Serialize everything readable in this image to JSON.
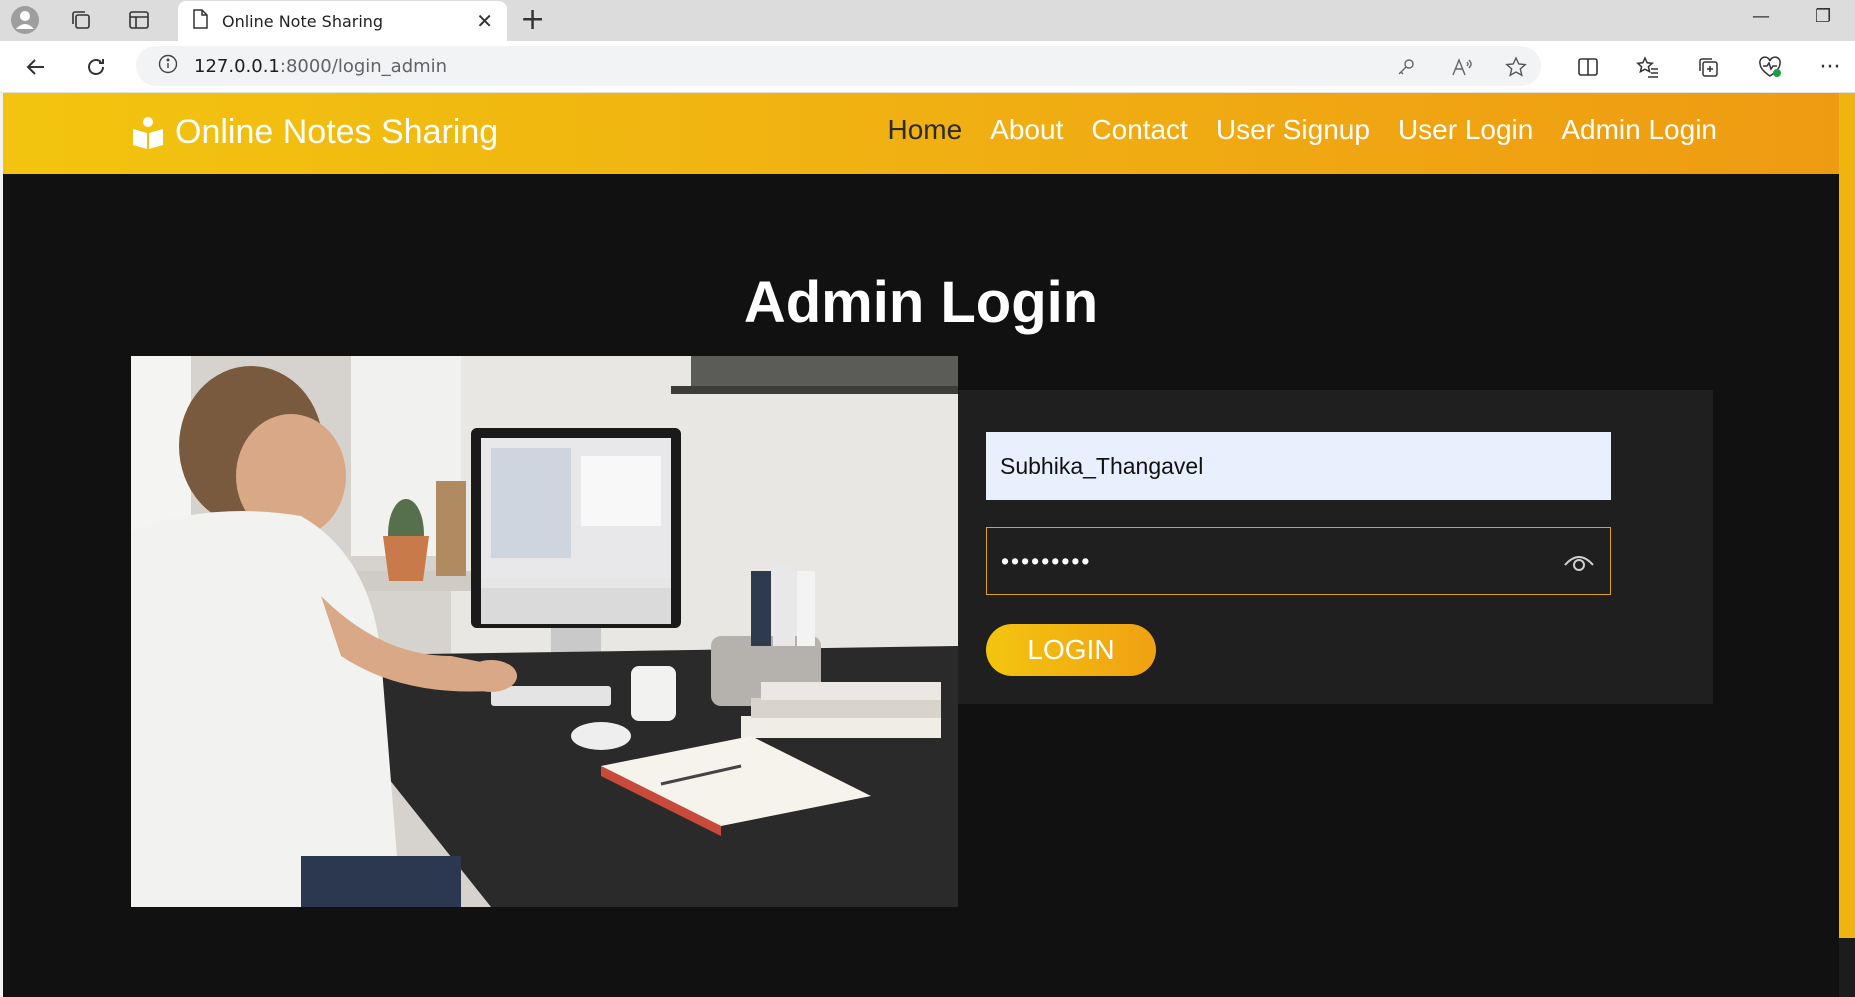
{
  "browser": {
    "tab_title": "Online Note Sharing",
    "tab_close": "✕",
    "new_tab": "+",
    "minimize": "—",
    "restore": "❐",
    "address": {
      "host": "127.0.0.1",
      "path": ":8000/login_admin"
    },
    "more": "···"
  },
  "site": {
    "brand": "Online Notes Sharing",
    "nav": [
      {
        "label": "Home",
        "active": true
      },
      {
        "label": "About"
      },
      {
        "label": "Contact"
      },
      {
        "label": "User Signup"
      },
      {
        "label": "User Login"
      },
      {
        "label": "Admin Login"
      }
    ],
    "page_title": "Admin Login",
    "form": {
      "username_value": "Subhika_Thangavel",
      "password_value": "•••••••••",
      "login_button": "LOGIN"
    }
  },
  "colors": {
    "accent": "#f2b10f",
    "page_bg": "#111111",
    "panel_bg": "#1f1f1f"
  }
}
